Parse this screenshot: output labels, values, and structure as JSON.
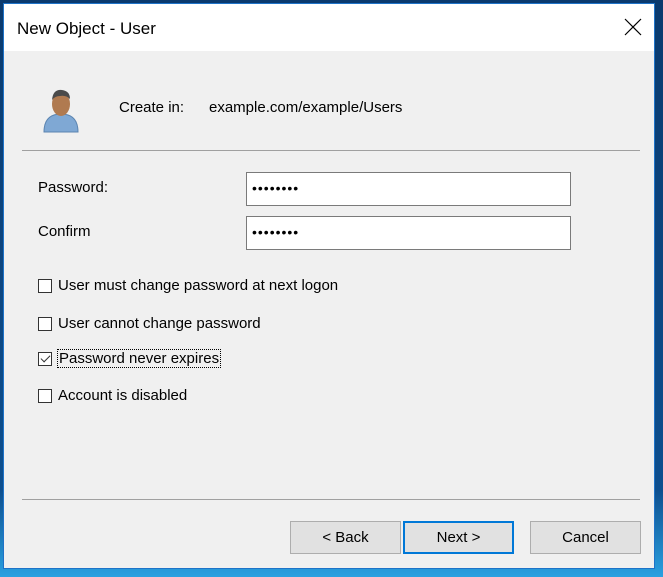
{
  "window": {
    "title": "New Object - User"
  },
  "header": {
    "create_in_label": "Create in:",
    "create_in_value": "example.com/example/Users"
  },
  "form": {
    "password": {
      "label": "Password:",
      "value": "••••••••"
    },
    "confirm": {
      "label": "Confirm",
      "value": "••••••••"
    }
  },
  "options": [
    {
      "label": "User must change password at next logon",
      "checked": false
    },
    {
      "label": "User cannot change password",
      "checked": false
    },
    {
      "label": "Password never expires",
      "checked": true
    },
    {
      "label": "Account is disabled",
      "checked": false
    }
  ],
  "buttons": {
    "back": "< Back",
    "next": "Next >",
    "cancel": "Cancel"
  }
}
